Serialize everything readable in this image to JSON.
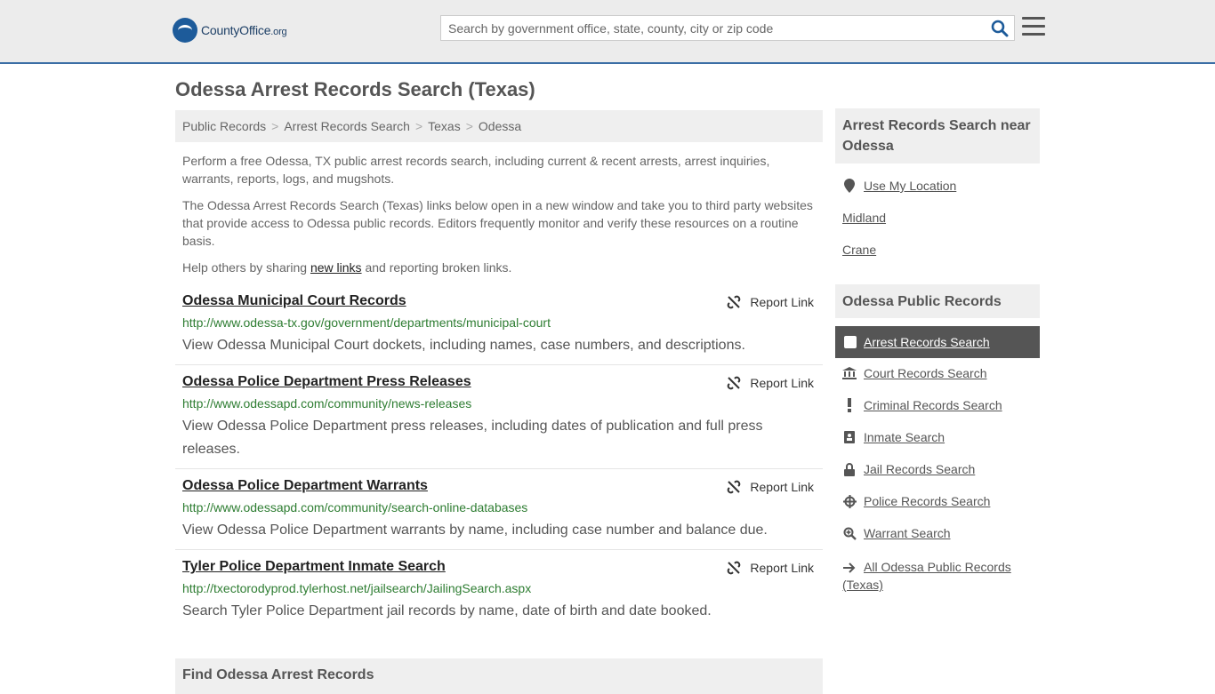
{
  "header": {
    "logo_county": "County",
    "logo_office": "Office",
    "logo_org": ".org",
    "search_placeholder": "Search by government office, state, county, city or zip code"
  },
  "page_title": "Odessa Arrest Records Search (Texas)",
  "breadcrumb": [
    "Public Records",
    "Arrest Records Search",
    "Texas",
    "Odessa"
  ],
  "intro": {
    "p1": "Perform a free Odessa, TX public arrest records search, including current & recent arrests, arrest inquiries, warrants, reports, logs, and mugshots.",
    "p2": "The Odessa Arrest Records Search (Texas) links below open in a new window and take you to third party websites that provide access to Odessa public records. Editors frequently monitor and verify these resources on a routine basis.",
    "p3_before": "Help others by sharing ",
    "p3_link": "new links",
    "p3_after": " and reporting broken links."
  },
  "report_label": "Report Link",
  "listings": [
    {
      "title": "Odessa Municipal Court Records",
      "url": "http://www.odessa-tx.gov/government/departments/municipal-court",
      "desc": "View Odessa Municipal Court dockets, including names, case numbers, and descriptions."
    },
    {
      "title": "Odessa Police Department Press Releases",
      "url": "http://www.odessapd.com/community/news-releases",
      "desc": "View Odessa Police Department press releases, including dates of publication and full press releases."
    },
    {
      "title": "Odessa Police Department Warrants",
      "url": "http://www.odessapd.com/community/search-online-databases",
      "desc": "View Odessa Police Department warrants by name, including case number and balance due."
    },
    {
      "title": "Tyler Police Department Inmate Search",
      "url": "http://txectorodyprod.tylerhost.net/jailsearch/JailingSearch.aspx",
      "desc": "Search Tyler Police Department jail records by name, date of birth and date booked."
    }
  ],
  "find_heading": "Find Odessa Arrest Records",
  "sidebar": {
    "near_heading": "Arrest Records Search near Odessa",
    "use_location": "Use My Location",
    "near_cities": [
      "Midland",
      "Crane"
    ],
    "public_heading": "Odessa Public Records",
    "active_item": "Arrest Records Search",
    "items": [
      {
        "label": "Court Records Search",
        "icon": "courthouse-icon"
      },
      {
        "label": "Criminal Records Search",
        "icon": "exclamation-icon"
      },
      {
        "label": "Inmate Search",
        "icon": "id-badge-icon"
      },
      {
        "label": "Jail Records Search",
        "icon": "lock-icon"
      },
      {
        "label": "Police Records Search",
        "icon": "crosshair-icon"
      },
      {
        "label": "Warrant Search",
        "icon": "magnify-icon"
      }
    ],
    "all_records": "All Odessa Public Records (Texas)"
  }
}
